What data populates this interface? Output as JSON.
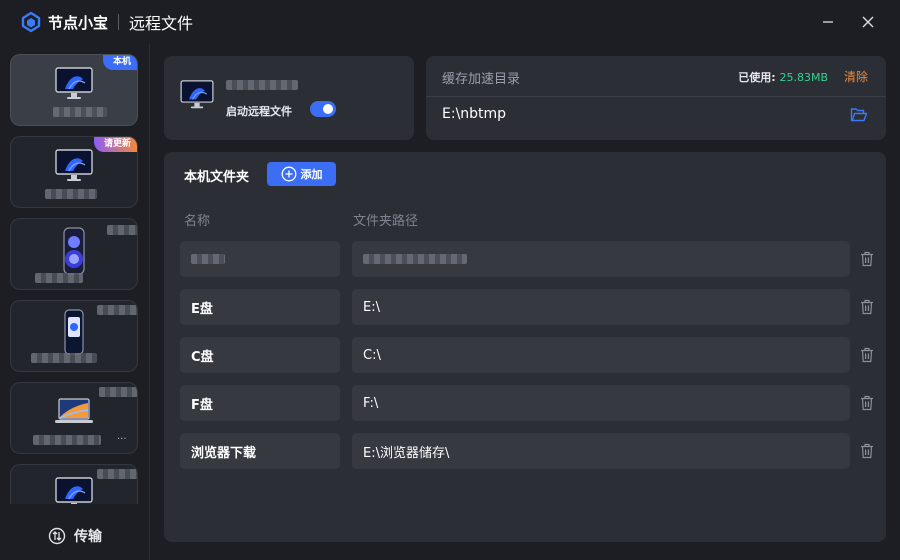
{
  "app": {
    "name": "节点小宝",
    "window_title": "远程文件"
  },
  "sidebar": {
    "devices": [
      {
        "badge": "本机",
        "badge_type": "local",
        "thumb": "monitor",
        "active": true
      },
      {
        "badge": "请更新",
        "badge_type": "update",
        "thumb": "monitor",
        "active": false
      },
      {
        "badge": "",
        "thumb": "phone-blue",
        "active": false
      },
      {
        "badge": "",
        "thumb": "phone-white",
        "active": false
      },
      {
        "badge": "",
        "thumb": "laptop",
        "active": false,
        "suffix": "..."
      },
      {
        "badge": "",
        "thumb": "monitor",
        "active": false
      }
    ],
    "transfer_label": "传输"
  },
  "remote_files": {
    "toggle_label": "启动远程文件",
    "enabled": true
  },
  "cache": {
    "title": "缓存加速目录",
    "used_label": "已使用:",
    "used_value": "25.83MB",
    "clear_label": "清除",
    "path": "E:\\nbtmp"
  },
  "folders": {
    "title": "本机文件夹",
    "add_label": "添加",
    "col_name": "名称",
    "col_path": "文件夹路径",
    "rows": [
      {
        "name": "",
        "path": ""
      },
      {
        "name": "E盘",
        "path": "E:\\"
      },
      {
        "name": "C盘",
        "path": "C:\\"
      },
      {
        "name": "F盘",
        "path": "F:\\"
      },
      {
        "name": "浏览器下载",
        "path": "E:\\浏览器储存\\"
      }
    ]
  },
  "colors": {
    "accent": "#3b6ef5",
    "used_value": "#3ad08f",
    "clear": "#f08a3c",
    "panel": "#2b2e35"
  }
}
